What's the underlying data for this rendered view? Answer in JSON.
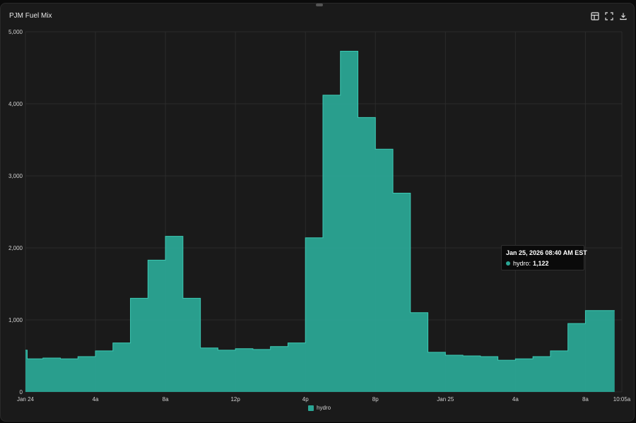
{
  "panel": {
    "title": "PJM Fuel Mix",
    "toolbar": [
      {
        "icon": "table-icon"
      },
      {
        "icon": "fullscreen-icon"
      },
      {
        "icon": "download-icon"
      }
    ]
  },
  "tooltip": {
    "title": "Jan 25, 2026 08:40 AM EST",
    "series_label": "hydro:",
    "value_label": "1,122"
  },
  "legend": {
    "label": "hydro"
  },
  "colors": {
    "series": "#2aa594",
    "series_line": "#3cc9b4",
    "grid": "#2b2b2b",
    "text": "#cfcfcf"
  },
  "chart_data": {
    "type": "area",
    "step": true,
    "title": "PJM Fuel Mix",
    "xlabel": "",
    "ylabel": "",
    "ylim": [
      0,
      5000
    ],
    "yticks": [
      0,
      1000,
      2000,
      3000,
      4000,
      5000
    ],
    "ytick_labels": [
      "0",
      "1,000",
      "2,000",
      "3,000",
      "4,000",
      "5,000"
    ],
    "xlim": [
      "Jan 24 00:00",
      "Jan 25 10:05"
    ],
    "xticks": [
      {
        "hour": 0,
        "label": "Jan 24"
      },
      {
        "hour": 4,
        "label": "4a"
      },
      {
        "hour": 8,
        "label": "8a"
      },
      {
        "hour": 12,
        "label": "12p"
      },
      {
        "hour": 16,
        "label": "4p"
      },
      {
        "hour": 20,
        "label": "8p"
      },
      {
        "hour": 24,
        "label": "Jan 25"
      },
      {
        "hour": 28,
        "label": "4a"
      },
      {
        "hour": 32,
        "label": "8a"
      },
      {
        "hour": 34.083,
        "label": "10:05a"
      }
    ],
    "grid": true,
    "legend_position": "bottom-center",
    "series": [
      {
        "name": "hydro",
        "hours": [
          0,
          0.1,
          1,
          2,
          3,
          4,
          5,
          6,
          7,
          8,
          9,
          10,
          11,
          12,
          13,
          14,
          15,
          16,
          17,
          18,
          19,
          20,
          21,
          22,
          23,
          24,
          25,
          26,
          27,
          28,
          29,
          30,
          31,
          32,
          33
        ],
        "values": [
          580,
          460,
          470,
          460,
          490,
          570,
          680,
          1300,
          1830,
          2160,
          1300,
          610,
          580,
          600,
          590,
          630,
          680,
          2140,
          4120,
          4730,
          3810,
          3370,
          2760,
          1100,
          550,
          510,
          500,
          490,
          440,
          460,
          490,
          570,
          950,
          1130,
          1130
        ],
        "end_hour": 33.67
      }
    ]
  }
}
